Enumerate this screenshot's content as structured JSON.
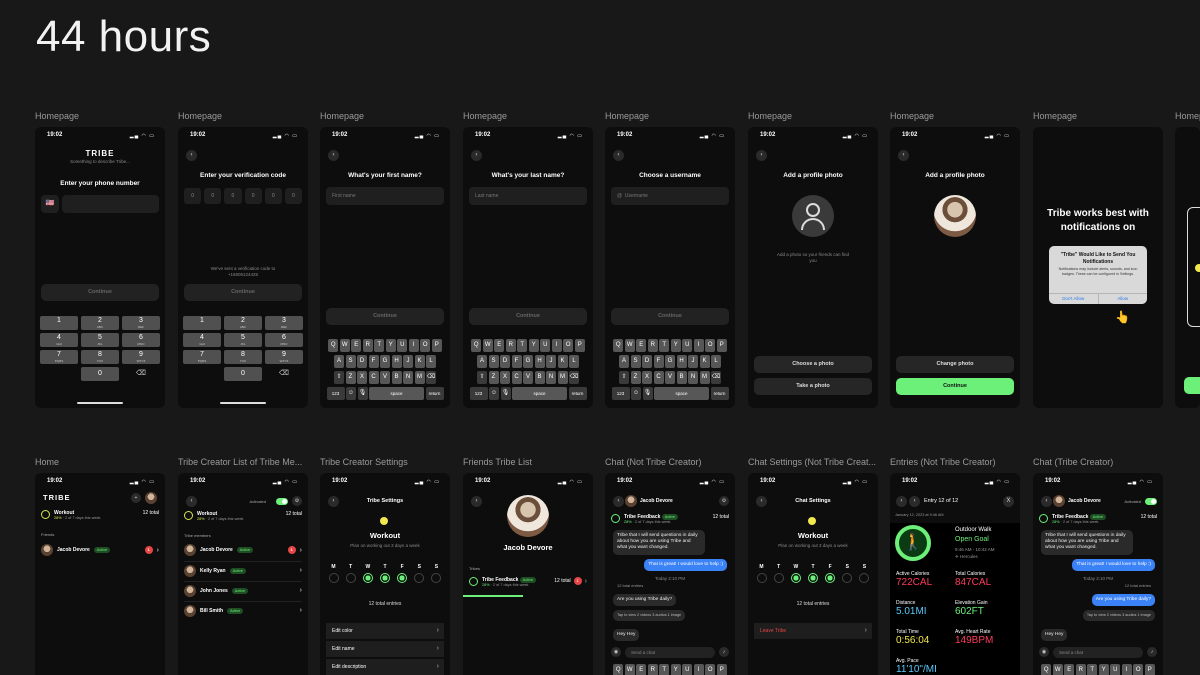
{
  "page_title": "44 hours",
  "status_time": "19:02",
  "status_icons": "▂▄ ◠ ▭",
  "colors": {
    "accent_green": "#6cf07a",
    "accent_yellow": "#d8e84a",
    "badge_red": "#e64545",
    "bubble_blue": "#3b82f6"
  },
  "row1_labels": [
    "Homepage",
    "Homepage",
    "Homepage",
    "Homepage",
    "Homepage",
    "Homepage",
    "Homepage",
    "Homepage",
    "Homepage"
  ],
  "row2_labels": [
    "Home",
    "Tribe Creator List of Tribe Me...",
    "Tribe Creator Settings",
    "Friends Tribe List",
    "Chat (Not Tribe Creator)",
    "Chat Settings (Not Tribe Creat...",
    "Entries (Not Tribe Creator)",
    "Chat (Tribe Creator)"
  ],
  "screens": {
    "phone": {
      "logo": "TRIBE",
      "tagline": "Something to describe Tribe...",
      "heading": "Enter your phone number",
      "flag": "🇺🇸",
      "continue": "Continue"
    },
    "verify": {
      "heading": "Enter your verification code",
      "digits": [
        "0",
        "0",
        "0",
        "0",
        "0",
        "0"
      ],
      "note": "We've sent a verification code to +16505124425",
      "continue": "Continue"
    },
    "first": {
      "heading": "What's your first name?",
      "placeholder": "First name",
      "continue": "Continue"
    },
    "last": {
      "heading": "What's your last name?",
      "placeholder": "Last name",
      "continue": "Continue"
    },
    "username": {
      "heading": "Choose a username",
      "at": "@",
      "placeholder": "Username",
      "continue": "Continue"
    },
    "photo": {
      "heading": "Add a profile photo",
      "note": "Add a photo so your friends can find you",
      "choose": "Choose a photo",
      "take": "Take a photo"
    },
    "photo2": {
      "heading": "Add a profile photo",
      "change": "Change photo",
      "continue": "Continue"
    },
    "notif": {
      "heading": "Tribe works best with notifications on",
      "dialog_title": "\"Tribe\" Would Like to Send You Notifications",
      "dialog_msg": "Notifications may include alerts, sounds, and icon badges. These can be configured in Settings.",
      "deny": "Don't Allow",
      "allow": "Allow"
    }
  },
  "numpad": [
    {
      "n": "1",
      "l": ""
    },
    {
      "n": "2",
      "l": "ABC"
    },
    {
      "n": "3",
      "l": "DEF"
    },
    {
      "n": "4",
      "l": "GHI"
    },
    {
      "n": "5",
      "l": "JKL"
    },
    {
      "n": "6",
      "l": "MNO"
    },
    {
      "n": "7",
      "l": "PQRS"
    },
    {
      "n": "8",
      "l": "TUV"
    },
    {
      "n": "9",
      "l": "WXYZ"
    },
    {
      "n": "",
      "l": ""
    },
    {
      "n": "0",
      "l": ""
    },
    {
      "n": "⌫",
      "l": ""
    }
  ],
  "keyboard": {
    "row1": [
      "Q",
      "W",
      "E",
      "R",
      "T",
      "Y",
      "U",
      "I",
      "O",
      "P"
    ],
    "row2": [
      "A",
      "S",
      "D",
      "F",
      "G",
      "H",
      "J",
      "K",
      "L"
    ],
    "row3": [
      "⇧",
      "Z",
      "X",
      "C",
      "V",
      "B",
      "N",
      "M",
      "⌫"
    ],
    "row4": [
      "123",
      "☺",
      "🎙",
      "space",
      "return"
    ]
  },
  "home": {
    "logo": "TRIBE",
    "workout": "Workout",
    "pct": "28%",
    "progress": "· 2 of 7 days this week",
    "total": "12 total",
    "friends": "Friends",
    "name": "Jacob Devore",
    "active": "Active",
    "badge": "1"
  },
  "members": {
    "activated": "Activated",
    "workout": "Workout",
    "pct": "28%",
    "progress": "· 2 of 7 days this week",
    "total": "12 total",
    "section": "Tribe members",
    "list": [
      {
        "name": "Jacob Devore",
        "active": "Active",
        "badge": "1"
      },
      {
        "name": "Kelly Ryan",
        "active": "Active",
        "badge": ""
      },
      {
        "name": "John Jones",
        "active": "Active",
        "badge": ""
      },
      {
        "name": "Bill Smith",
        "active": "Active",
        "badge": ""
      }
    ]
  },
  "settings": {
    "title": "Tribe Settings",
    "name": "Workout",
    "plan": "Plan on working out 3 days a week",
    "days": [
      "M",
      "T",
      "W",
      "T",
      "F",
      "S",
      "S"
    ],
    "done": [
      false,
      false,
      true,
      true,
      true,
      false,
      false
    ],
    "entries": "12 total entries",
    "rows": [
      "Edit color",
      "Edit name",
      "Edit description"
    ]
  },
  "friends": {
    "name": "Jacob Devore",
    "section": "Tribes",
    "tribe": "Tribe Feedback",
    "active": "Active",
    "pct": "28%",
    "progress": "· 2 of 7 days this week",
    "total": "12 total",
    "badge": "1"
  },
  "chat": {
    "name": "Jacob Devore",
    "tribe": "Tribe Feedback",
    "active": "Active",
    "pct": "28%",
    "progress": "· 2 of 7 days this week",
    "total": "12 total",
    "msg1": "Tribe that I will send questions in daily about how you are using Tribe and what you want changed.",
    "msg2": "That is great! I would love to help :)",
    "time": "Today 2:10 PM",
    "entries": "12 total entries",
    "msg3": "Are you using Tribe daily?",
    "attach": "Tap to view  2 videos  3 audios  1 image",
    "msg4": "Hey Hey",
    "placeholder": "Send a chat"
  },
  "chatset": {
    "title": "Chat Settings",
    "name": "Workout",
    "plan": "Plan on working out 3 days a week",
    "days": [
      "M",
      "T",
      "W",
      "T",
      "F",
      "S",
      "S"
    ],
    "done": [
      false,
      false,
      true,
      true,
      true,
      false,
      false
    ],
    "entries": "12 total entries",
    "leave": "Leave Tribe"
  },
  "entries": {
    "nav": "Entry 12 of 12",
    "close": "X",
    "date": "January 12, 2023 at 9:46 AM",
    "activity": "Outdoor Walk",
    "goal": "Open Goal",
    "time": "9:46 AM - 10:42 AM",
    "place": "✈ Hercules",
    "stats": [
      {
        "k": "Active Calories",
        "v": "722CAL",
        "c": "#ff3b5c"
      },
      {
        "k": "Total Calories",
        "v": "847CAL",
        "c": "#ff3b5c"
      },
      {
        "k": "Distance",
        "v": "5.01MI",
        "c": "#5ac8fa"
      },
      {
        "k": "Elevation Gain",
        "v": "602FT",
        "c": "#6cf07a"
      },
      {
        "k": "Total Time",
        "v": "0:56:04",
        "c": "#f2e94e"
      },
      {
        "k": "Avg. Heart Rate",
        "v": "149BPM",
        "c": "#ff3b5c"
      },
      {
        "k": "Avg. Pace",
        "v": "11'10\"/MI",
        "c": "#5ac8fa"
      }
    ]
  },
  "chat2": {
    "name": "Jacob Devore",
    "activated": "Activated",
    "tribe": "Tribe Feedback",
    "active": "Active",
    "pct": "28%",
    "progress": "· 2 of 7 days this week",
    "total": "12 total",
    "msg1": "Tribe that I will send questions in daily about how you are using Tribe and what you want changed.",
    "msg2": "That is great! I would love to help :)",
    "time": "Today 2:10 PM",
    "entries": "12 total entries",
    "msg3": "Are you using Tribe daily?",
    "attach": "Tap to view  2 videos  3 audios  1 image",
    "msg4": "Hey Hey",
    "placeholder": "Send a chat"
  }
}
